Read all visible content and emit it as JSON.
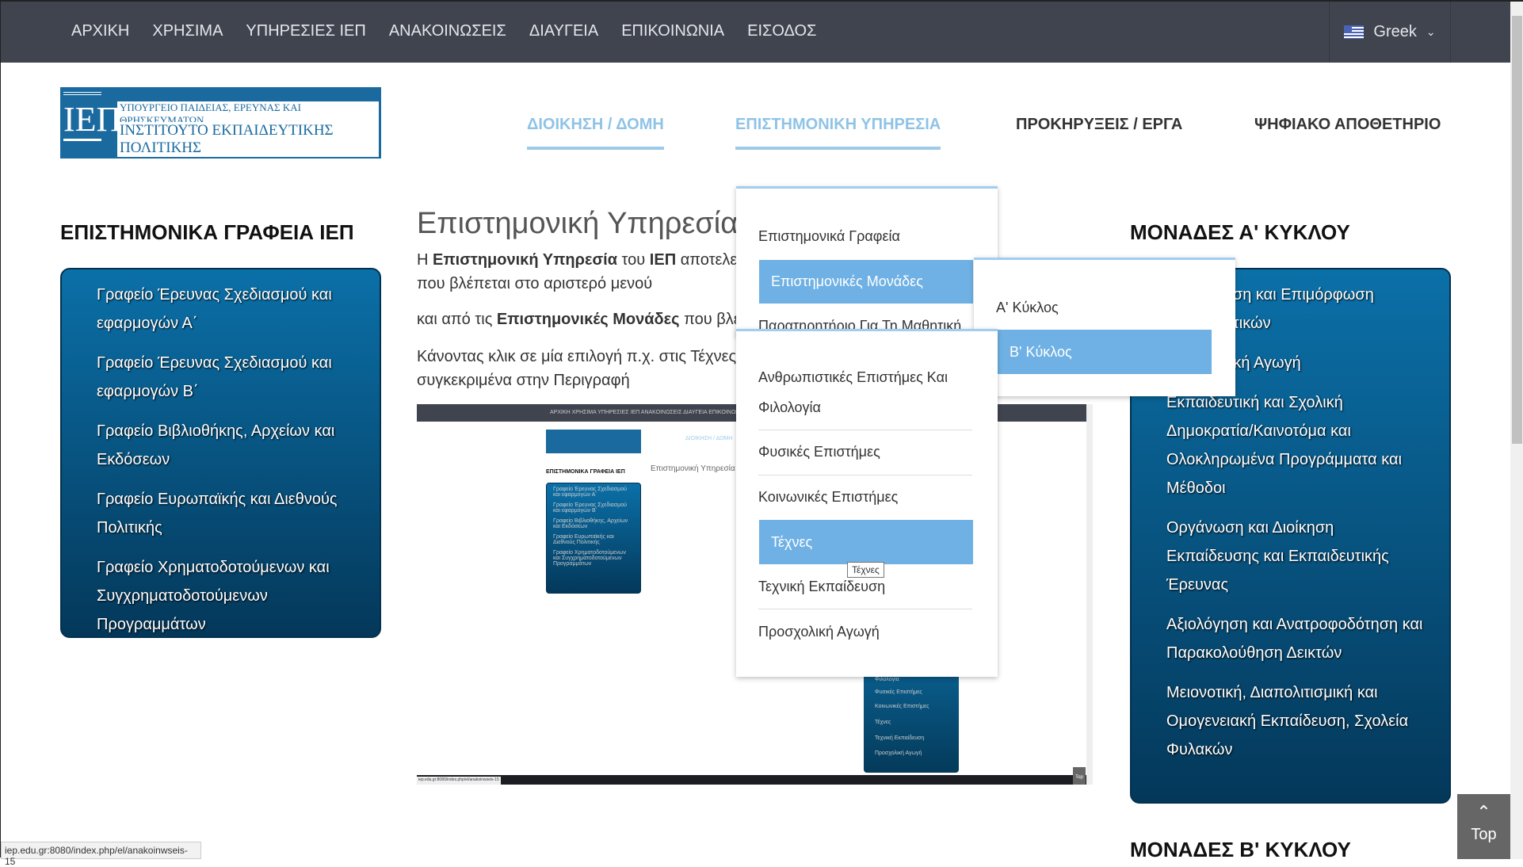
{
  "topnav": [
    "ΑΡΧΙΚΗ",
    "ΧΡΗΣΙΜΑ",
    "ΥΠΗΡΕΣΙΕΣ ΙΕΠ",
    "ΑΝΑΚΟΙΝΩΣΕΙΣ",
    "ΔΙΑΥΓΕΙΑ",
    "ΕΠΙΚΟΙΝΩΝΙΑ",
    "ΕΙΣΟΔΟΣ"
  ],
  "language": {
    "label": "Greek",
    "icon": "greek-flag-icon"
  },
  "logo": {
    "mark": "ΙΕΠ",
    "line1": "ΥΠΟΥΡΓΕΙΟ ΠΑΙΔΕΙΑΣ, ΕΡΕΥΝΑΣ ΚΑΙ ΘΡΗΣΚΕΥΜΑΤΩΝ",
    "line2": "ΙΝΣΤΙΤΟΥΤΟ ΕΚΠΑΙΔΕΥΤΙΚΗΣ ΠΟΛΙΤΙΚΗΣ"
  },
  "mainnav": [
    "ΔΙΟΙΚΗΣΗ / ΔΟΜΗ",
    "ΕΠΙΣΤΗΜΟΝΙΚΗ ΥΠΗΡΕΣΙΑ",
    "ΠΡΟΚΗΡΥΞΕΙΣ / ΕΡΓΑ",
    "ΨΗΦΙΑΚΟ ΑΠΟΘΕΤΗΡΙΟ"
  ],
  "left": {
    "title": "ΕΠΙΣΤΗΜΟΝΙΚΑ ΓΡΑΦΕΙΑ ΙΕΠ",
    "items": [
      "Γραφείο Έρευνας Σχεδιασμού και εφαρμογών Α΄",
      "Γραφείο Έρευνας Σχεδιασμού και εφαρμογών Β΄",
      "Γραφείο Βιβλιοθήκης, Αρχείων και Εκδόσεων",
      "Γραφείο Ευρωπαϊκής και Διεθνούς Πολιτικής",
      "Γραφείο Χρηματοδοτούμενων και Συγχρηματοδοτούμενων Προγραμμάτων"
    ]
  },
  "content": {
    "title": "Επιστημονική Υπηρεσία ΙΕΠ",
    "p1a": "Η ",
    "p1b": "Επιστημονική Υπηρεσία",
    "p1c": " του ",
    "p1d": "ΙΕΠ",
    "p1e": " αποτελείται από",
    "p1line2": "που βλέπεται στο αριστερό μενού",
    "p2a": "και από τις ",
    "p2b": "Επιστημονικές Μονάδες",
    "p2c": " που βλέπεται",
    "p3": "Κάνοντας κλικ σε μία επιλογή π.χ. στις Τέχνες",
    "p3line2": "συγκεκριμένα στην Περιγραφή"
  },
  "mini": {
    "nav": "ΑΡΧΙΚΗ   ΧΡΗΣΙΜΑ   ΥΠΗΡΕΣΙΕΣ ΙΕΠ   ΑΝΑΚΟΙΝΩΣΕΙΣ   ΔΙΑΥΓΕΙΑ   ΕΠΙΚΟΙΝΩΝΙΑ",
    "menu": "ΔΙΟΙΚΗΣΗ / ΔΟΜΗ",
    "heading": "ΕΠΙΣΤΗΜΟΝΙΚΑ ΓΡΑΦΕΙΑ ΙΕΠ",
    "title": "Επιστημονική Υπηρεσία",
    "left_items": [
      "Γραφείο Έρευνας Σχεδιασμού και εφαρμογών Α΄",
      "Γραφείο Έρευνας Σχεδιασμού και εφαρμογών Β΄",
      "Γραφείο Βιβλιοθήκης, Αρχείων και Εκδόσεων",
      "Γραφείο Ευρωπαϊκής και Διεθνούς Πολιτικής",
      "Γραφείο Χρηματοδοτούμενων και Συγχρηματοδοτούμενων Προγραμμάτων"
    ],
    "dark_items": [
      "Φιλολογία",
      "Φυσικές Επιστήμες",
      "Κοινωνικές Επιστήμες",
      "Τέχνες",
      "Τεχνική Εκπαίδευση",
      "Προσχολική Αγωγή"
    ],
    "status": "iep.edu.gr:8080/index.php/el/anakoinwseis-15",
    "top": "Top"
  },
  "dropdown": {
    "items": [
      "Επιστημονικά Γραφεία",
      "Επιστημονικές Μονάδες",
      "Παρατηρητήριο Για Τη Μαθητική"
    ],
    "sub": [
      "Α' Κύκλος",
      "Β' Κύκλος"
    ],
    "sub2": [
      "Ανθρωπιστικές Επιστήμες Και",
      "Φιλολογία",
      "Φυσικές Επιστήμες",
      "Κοινωνικές Επιστήμες",
      "Τέχνες",
      "Τεχνική Εκπαίδευση",
      "Προσχολική Αγωγή"
    ],
    "tooltip": "Τέχνες"
  },
  "right": {
    "title": "ΜΟΝΑΔΕΣ Α' ΚΥΚΛΟΥ",
    "items": [
      "Εκπαίδευση και Επιμόρφωση Εκπαιδευτικών",
      "Προσχολική Αγωγή",
      "Εκπαιδευτική και Σχολική Δημοκρατία/Καινοτόμα και Ολοκληρωμένα Προγράμματα και Μέθοδοι",
      "Οργάνωση και Διοίκηση Εκπαίδευσης και Εκπαιδευτικής Έρευνας",
      "Αξιολόγηση και Ανατροφοδότηση και Παρακολούθηση Δεικτών",
      "Μειονοτική, Διαπολιτισμική και Ομογενειακή Εκπαίδευση, Σχολεία Φυλακών"
    ],
    "title2": "ΜΟΝΑΔΕΣ Β' ΚΥΚΛΟΥ"
  },
  "top_button": "Top",
  "status_url": "iep.edu.gr:8080/index.php/el/anakoinwseis-15",
  "colors": {
    "topbar": "#40444f",
    "accent": "#6fb1e4",
    "box": "#0b70a8"
  }
}
